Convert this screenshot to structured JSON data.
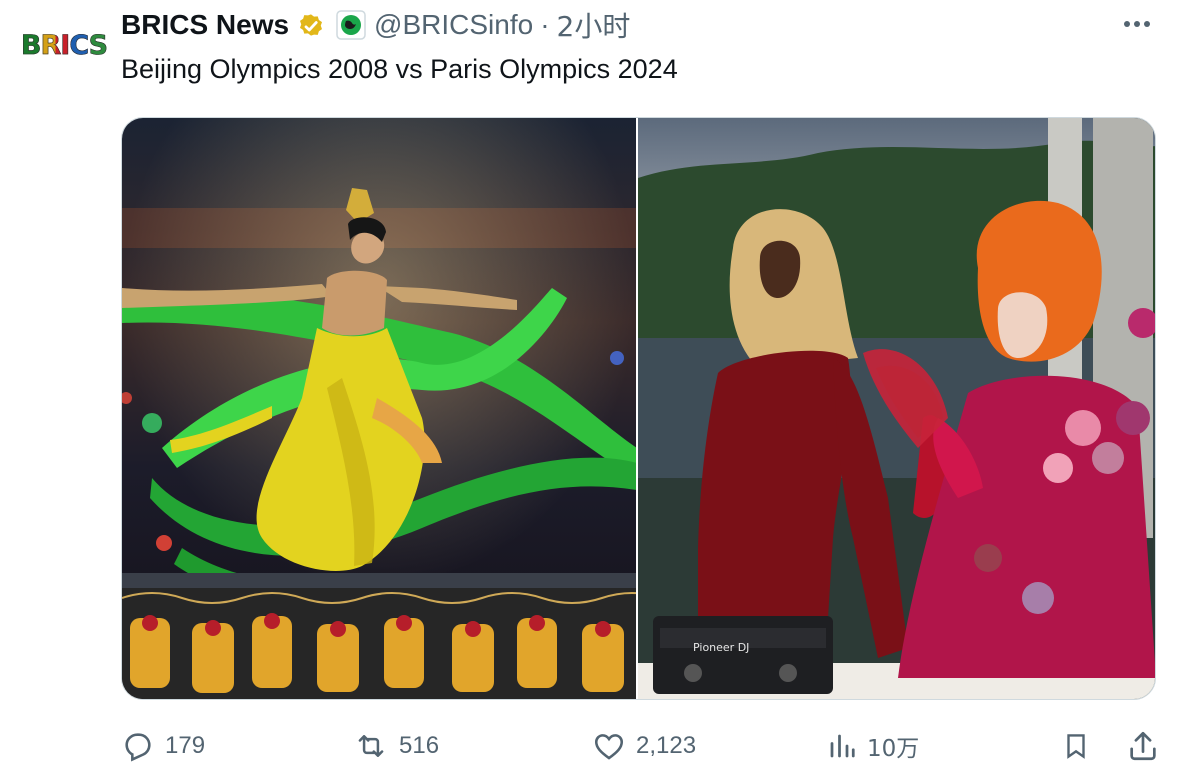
{
  "author": {
    "avatar_text": "BRICS",
    "name": "BRICS News",
    "handle": "@BRICSinfo",
    "separator": "·",
    "time": "2小时"
  },
  "tweet": {
    "text": "Beijing Olympics 2008 vs Paris Olympics 2024"
  },
  "media": [
    {
      "icon": "beijing-photo",
      "text_in_photo": ""
    },
    {
      "icon": "paris-photo",
      "text_in_photo": "Pioneer DJ"
    }
  ],
  "actions": {
    "reply": {
      "icon": "reply-icon",
      "count": "179"
    },
    "retweet": {
      "icon": "retweet-icon",
      "count": "516"
    },
    "like": {
      "icon": "heart-icon",
      "count": "2,123"
    },
    "views": {
      "icon": "analytics-icon",
      "count": "10万"
    },
    "bookmark": {
      "icon": "bookmark-icon"
    },
    "share": {
      "icon": "share-icon"
    }
  },
  "colors": {
    "text": "#0f1419",
    "secondary": "#536471",
    "verified_gold": "#e2b719",
    "border": "#cfd9de"
  }
}
